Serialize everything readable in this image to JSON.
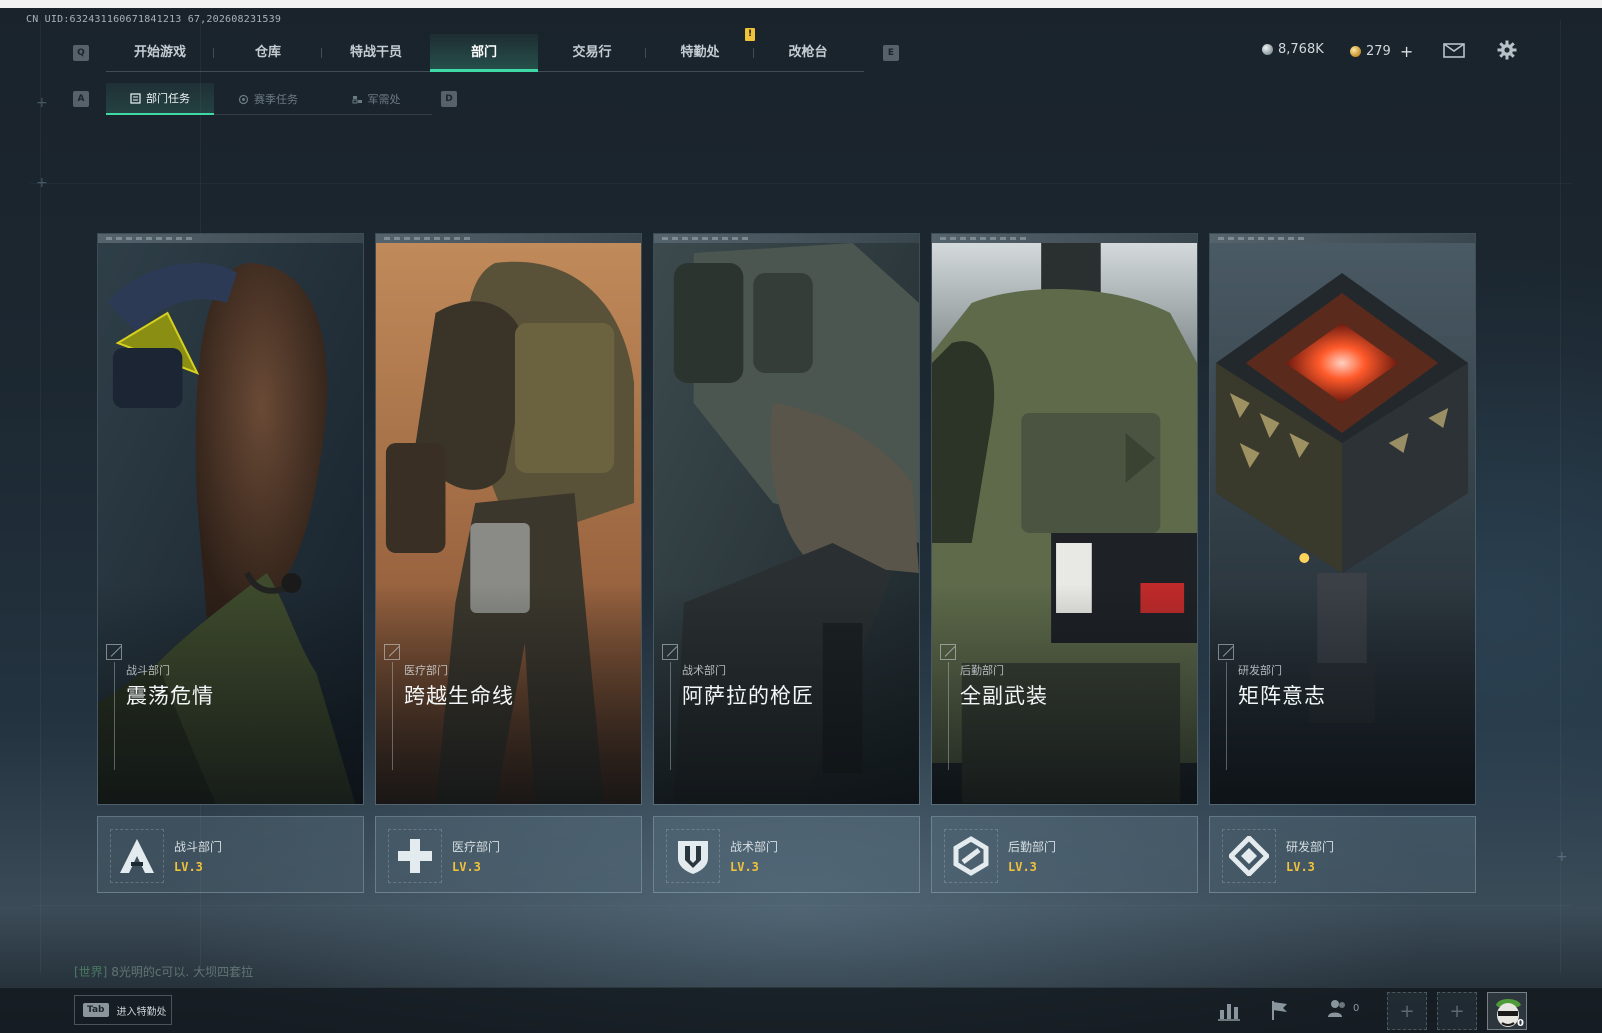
{
  "uid": "CN UID:632431160671841213 67,202608231539",
  "nav": {
    "left_key": "Q",
    "right_key": "E",
    "tabs": [
      {
        "label": "开始游戏"
      },
      {
        "label": "仓库"
      },
      {
        "label": "特战干员"
      },
      {
        "label": "部门",
        "active": true
      },
      {
        "label": "交易行"
      },
      {
        "label": "特勤处"
      },
      {
        "label": "改枪台"
      }
    ],
    "alert_badge": "!"
  },
  "sub_nav": {
    "left_key": "A",
    "right_key": "D",
    "tabs": [
      {
        "label": "部门任务",
        "active": true
      },
      {
        "label": "赛季任务"
      },
      {
        "label": "军需处"
      }
    ]
  },
  "currency": {
    "silver": "8,768K",
    "gold": "279",
    "add": "+"
  },
  "cards": [
    {
      "dept": "战斗部门",
      "title": "震荡危情",
      "badge_name": "战斗部门",
      "level": "LV.3"
    },
    {
      "dept": "医疗部门",
      "title": "跨越生命线",
      "badge_name": "医疗部门",
      "level": "LV.3"
    },
    {
      "dept": "战术部门",
      "title": "阿萨拉的枪匠",
      "badge_name": "战术部门",
      "level": "LV.3"
    },
    {
      "dept": "后勤部门",
      "title": "全副武装",
      "badge_name": "后勤部门",
      "level": "LV.3"
    },
    {
      "dept": "研发部门",
      "title": "矩阵意志",
      "badge_name": "研发部门",
      "level": "LV.3"
    }
  ],
  "chat": {
    "tag": "[世界]",
    "text": "8光明的c可以. 大坝四套拉"
  },
  "bottom": {
    "tab_key": "Tab",
    "tab_label": "进入特勤处",
    "friends_count": "0",
    "avatar_count": "0"
  },
  "colors": {
    "accent": "#3fd9a5",
    "level": "#f0c23a",
    "alert": "#f0c23a"
  }
}
